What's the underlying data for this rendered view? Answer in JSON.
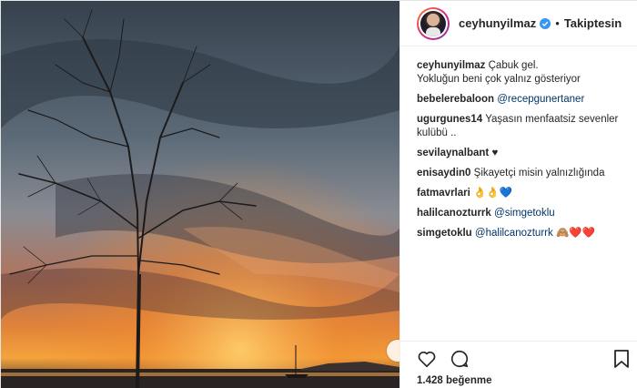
{
  "post": {
    "username": "ceyhunyilmaz",
    "separator": "•",
    "follow_status": "Takiptesin",
    "caption": {
      "user": "ceyhunyilmaz",
      "line1": "Çabuk gel.",
      "line2": "Yokluğun beni çok yalnız gösteriyor"
    },
    "comments": [
      {
        "user": "bebelerebaloon",
        "text": "",
        "mention": "@recepgunertaner",
        "emoji": ""
      },
      {
        "user": "ugurgunes14",
        "text": "Yaşasın menfaatsiz sevenler kulübü ..",
        "mention": "",
        "emoji": ""
      },
      {
        "user": "sevilaynalbant",
        "text": "",
        "mention": "",
        "emoji": "♥"
      },
      {
        "user": "enisaydin0",
        "text": "Şikayetçi misin yalnızlığında",
        "mention": "",
        "emoji": ""
      },
      {
        "user": "fatmavrlari",
        "text": "",
        "mention": "",
        "emoji": "👌👌💙"
      },
      {
        "user": "halilcanozturrk",
        "text": "",
        "mention": "@simgetoklu",
        "emoji": ""
      },
      {
        "user": "simgetoklu",
        "text": "",
        "mention": "@halilcanozturrk",
        "emoji": "🙈❤️❤️"
      }
    ],
    "likes": "1.428 beğenme"
  },
  "icons": [
    "verified-badge-icon",
    "heart-icon",
    "comment-icon",
    "bookmark-icon",
    "carousel-next-icon"
  ],
  "colors": {
    "mention": "#003569",
    "verified": "#3897f0",
    "text": "#262626"
  }
}
